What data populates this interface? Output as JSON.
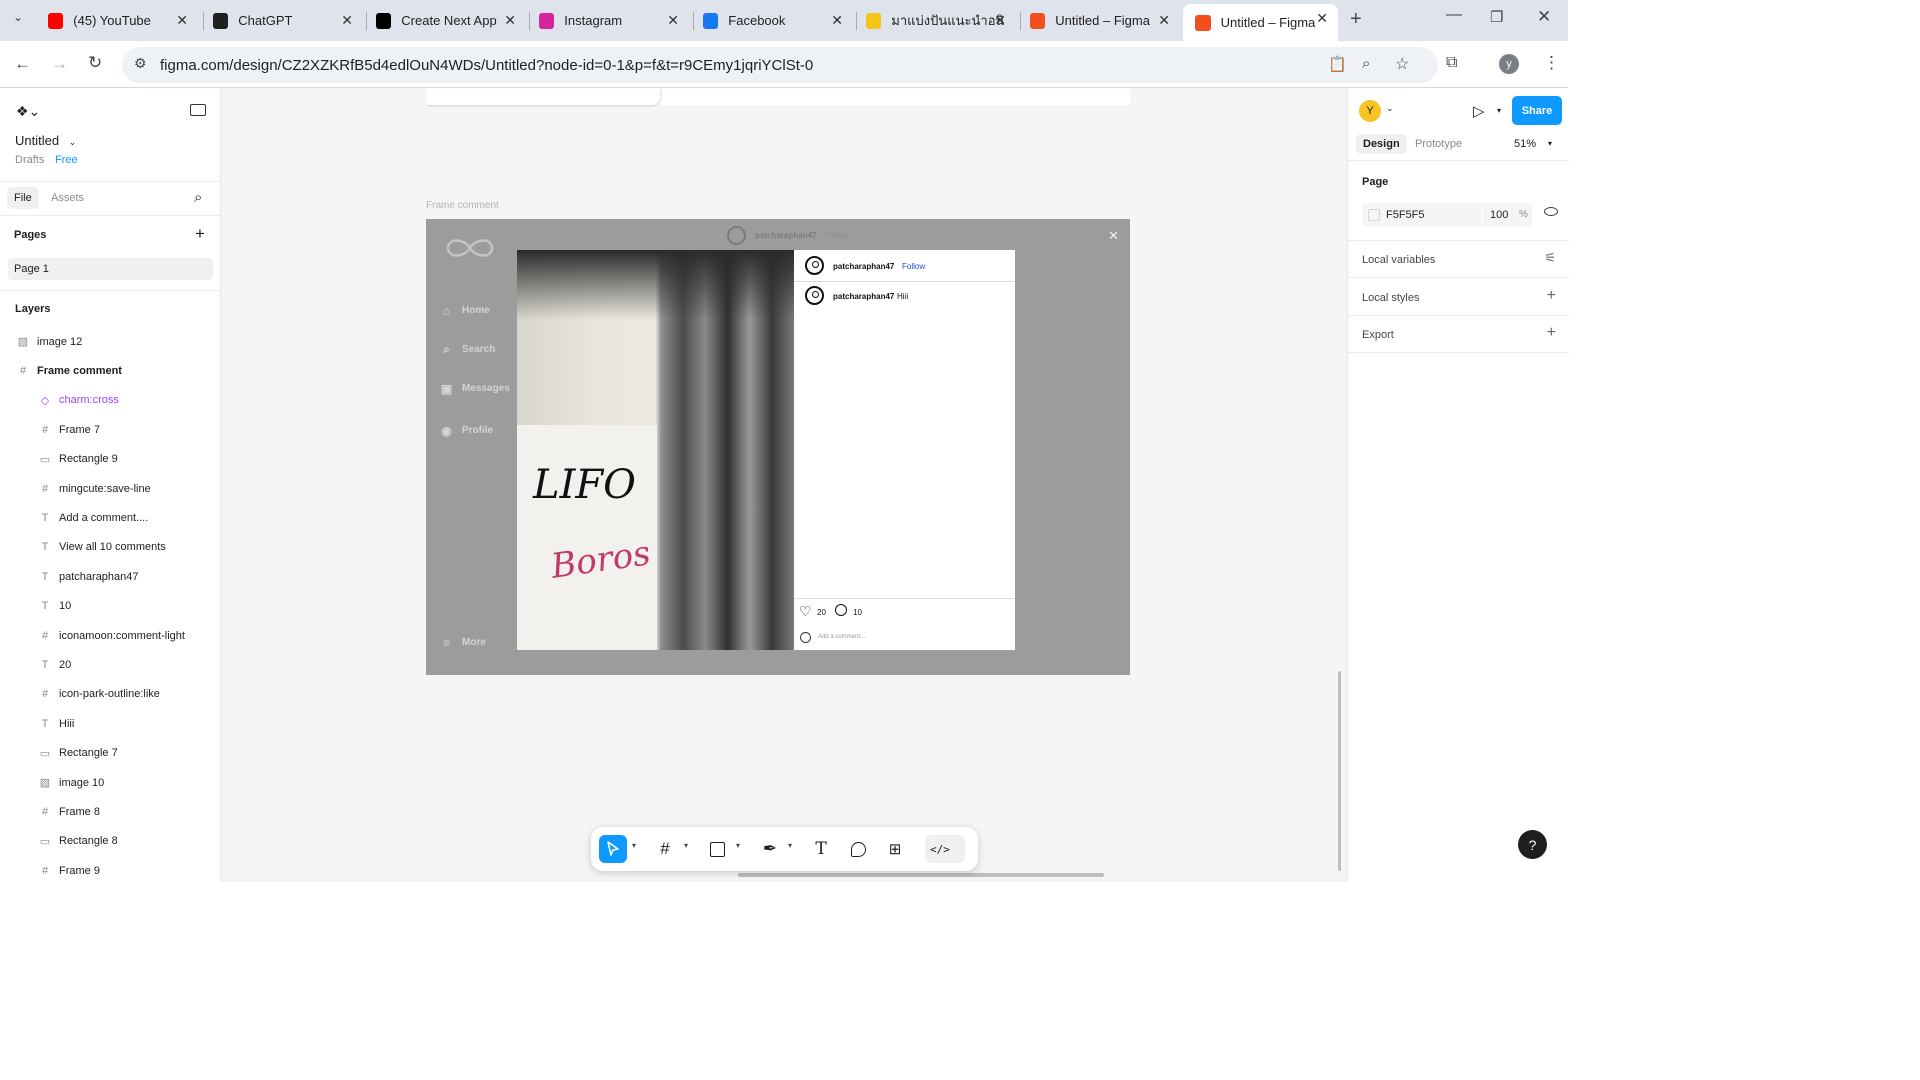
{
  "browser": {
    "tabs": [
      {
        "title": "(45) YouTube",
        "icon": "youtube-icon",
        "color": "#ff0000"
      },
      {
        "title": "ChatGPT",
        "icon": "chatgpt-icon",
        "color": "#202020"
      },
      {
        "title": "Create Next App",
        "icon": "nextjs-triangle-icon",
        "color": "#000000"
      },
      {
        "title": "Instagram",
        "icon": "instagram-icon",
        "color": "#d6249f"
      },
      {
        "title": "Facebook",
        "icon": "facebook-icon",
        "color": "#1877f2"
      },
      {
        "title": "มาแบ่งปันแนะนำอนิ",
        "icon": "emoji-icon",
        "color": "#f5c518"
      },
      {
        "title": "Untitled – Figma",
        "icon": "figma-icon",
        "color": "#f24e1e"
      },
      {
        "title": "Untitled – Figma",
        "icon": "figma-icon",
        "color": "#f24e1e"
      }
    ],
    "url": "figma.com/design/CZ2XZKRfB5d4edlOuN4WDs/Untitled?node-id=0-1&p=f&t=r9CEmy1jqriYClSt-0",
    "profile_initial": "y"
  },
  "file": {
    "name": "Untitled",
    "location": "Drafts",
    "plan": "Free"
  },
  "leftpanel": {
    "tab_file": "File",
    "tab_assets": "Assets",
    "pages_heading": "Pages",
    "pages": [
      "Page 1"
    ],
    "layers_heading": "Layers",
    "layers": [
      {
        "name": "image 12",
        "icon": "image-icon",
        "level": 1
      },
      {
        "name": "Frame comment",
        "icon": "frame-icon",
        "level": 1
      },
      {
        "name": "charm:cross",
        "icon": "component-icon",
        "level": 2
      },
      {
        "name": "Frame 7",
        "icon": "frame-icon",
        "level": 2
      },
      {
        "name": "Rectangle 9",
        "icon": "rectangle-icon",
        "level": 2
      },
      {
        "name": "mingcute:save-line",
        "icon": "frame-icon",
        "level": 2
      },
      {
        "name": "Add a comment....",
        "icon": "text-icon",
        "level": 2
      },
      {
        "name": "View all 10 comments",
        "icon": "text-icon",
        "level": 2
      },
      {
        "name": "patcharaphan47",
        "icon": "text-icon",
        "level": 2
      },
      {
        "name": "10",
        "icon": "text-icon",
        "level": 2
      },
      {
        "name": "iconamoon:comment-light",
        "icon": "frame-icon",
        "level": 2
      },
      {
        "name": "20",
        "icon": "text-icon",
        "level": 2
      },
      {
        "name": "icon-park-outline:like",
        "icon": "frame-icon",
        "level": 2
      },
      {
        "name": "Hiii",
        "icon": "text-icon",
        "level": 2
      },
      {
        "name": "Rectangle 7",
        "icon": "rectangle-icon",
        "level": 2
      },
      {
        "name": "image 10",
        "icon": "image-icon",
        "level": 2
      },
      {
        "name": "Frame 8",
        "icon": "frame-icon",
        "level": 2
      },
      {
        "name": "Rectangle 8",
        "icon": "rectangle-icon",
        "level": 2
      },
      {
        "name": "Frame 9",
        "icon": "frame-icon",
        "level": 2
      }
    ]
  },
  "canvas": {
    "frame_label": "Frame comment",
    "nav": [
      "Home",
      "Search",
      "Messages",
      "Profile"
    ],
    "nav_more": "More",
    "top_username": "patcharaphan47",
    "top_follow": "Follow",
    "post": {
      "username": "patcharaphan47",
      "follow": "Follow",
      "comment_user": "patcharaphan47",
      "comment_text": "Hiii",
      "likes": "20",
      "comments": "10",
      "add_comment": "Add a comment....",
      "graffiti_black": "LIFO",
      "graffiti_red": "Boros"
    }
  },
  "rightpanel": {
    "avatar_initial": "Y",
    "share": "Share",
    "tab_design": "Design",
    "tab_prototype": "Prototype",
    "zoom": "51%",
    "page_heading": "Page",
    "page_color": "F5F5F5",
    "page_opacity": "100",
    "page_opacity_unit": "%",
    "local_variables": "Local variables",
    "local_styles": "Local styles",
    "export": "Export"
  },
  "colors": {
    "figma_blue": "#0d99ff",
    "component_purple": "#9747ff",
    "canvas_bg": "#f5f5f5",
    "frame_overlay": "#9c9c9c"
  }
}
